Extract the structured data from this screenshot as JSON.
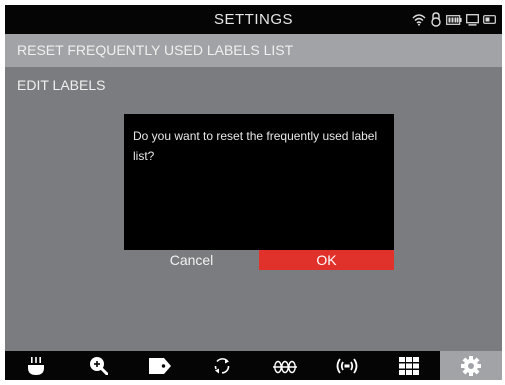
{
  "header": {
    "title": "SETTINGS"
  },
  "status_icons": [
    "wifi-icon",
    "lock-icon",
    "battery-icon",
    "monitor-icon",
    "toggle-icon"
  ],
  "menu": {
    "items": [
      {
        "label": "RESET FREQUENTLY USED LABELS LIST",
        "selected": true
      },
      {
        "label": "EDIT LABELS",
        "selected": false
      }
    ]
  },
  "dialog": {
    "message": "Do you want to reset the frequently used label list?",
    "cancel_label": "Cancel",
    "ok_label": "OK"
  },
  "toolbar": {
    "items": [
      {
        "icon": "cable-connector-icon",
        "active": false
      },
      {
        "icon": "zoom-in-icon",
        "active": false
      },
      {
        "icon": "tag-icon",
        "active": false
      },
      {
        "icon": "refresh-icon",
        "active": false
      },
      {
        "icon": "ohm-coil-icon",
        "active": false
      },
      {
        "icon": "signal-icon",
        "active": false
      },
      {
        "icon": "grid-icon",
        "active": false
      },
      {
        "icon": "gear-icon",
        "active": true
      }
    ]
  },
  "colors": {
    "background": "#7a7c80",
    "bar": "#050505",
    "highlight": "#a1a3a6",
    "accent": "#e0312b"
  }
}
